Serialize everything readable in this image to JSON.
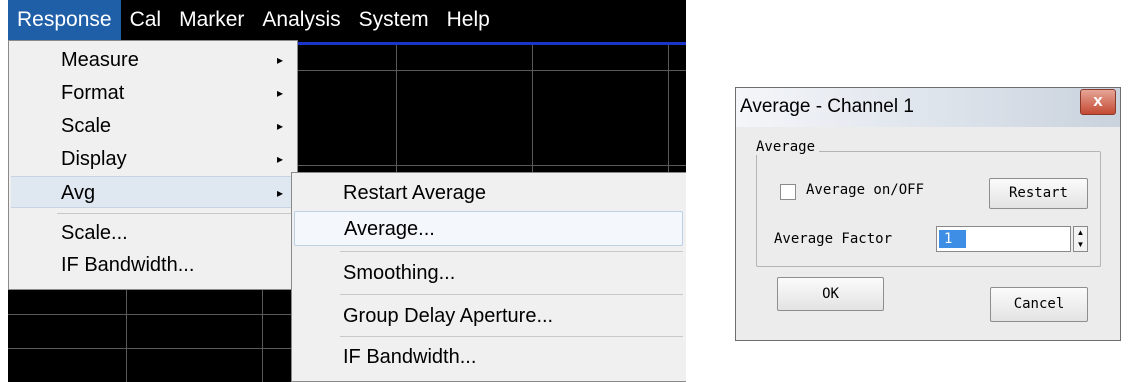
{
  "menubar": {
    "items": [
      {
        "label": "Response",
        "active": true
      },
      {
        "label": "Cal",
        "active": false
      },
      {
        "label": "Marker",
        "active": false
      },
      {
        "label": "Analysis",
        "active": false
      },
      {
        "label": "System",
        "active": false
      },
      {
        "label": "Help",
        "active": false
      }
    ]
  },
  "response_menu": {
    "items": [
      {
        "label": "Measure",
        "has_submenu": true
      },
      {
        "label": "Format",
        "has_submenu": true
      },
      {
        "label": "Scale",
        "has_submenu": true
      },
      {
        "label": "Display",
        "has_submenu": true
      },
      {
        "label": "Avg",
        "has_submenu": true,
        "highlighted": true
      },
      {
        "label": "Scale...",
        "has_submenu": false
      },
      {
        "label": "IF Bandwidth...",
        "has_submenu": false
      }
    ],
    "submenu_arrow": "▸"
  },
  "avg_submenu": {
    "items": [
      {
        "label": "Restart Average"
      },
      {
        "label": "Average...",
        "hovered": true
      },
      {
        "label": "Smoothing..."
      },
      {
        "label": "Group Delay Aperture..."
      },
      {
        "label": "IF Bandwidth..."
      }
    ]
  },
  "dialog": {
    "title": "Average - Channel 1",
    "close_glyph": "x",
    "group_label": "Average",
    "average_on_label": "Average on/OFF",
    "average_on_checked": false,
    "restart_label": "Restart",
    "factor_label": "Average Factor",
    "factor_value": "1",
    "spin_up": "▲",
    "spin_down": "▼",
    "ok_label": "OK",
    "cancel_label": "Cancel"
  },
  "colors": {
    "menu_highlight": "#1f5fa8",
    "screen_bg": "#000000",
    "trace_line": "#1a35c8",
    "selection": "#3f8ee6"
  }
}
